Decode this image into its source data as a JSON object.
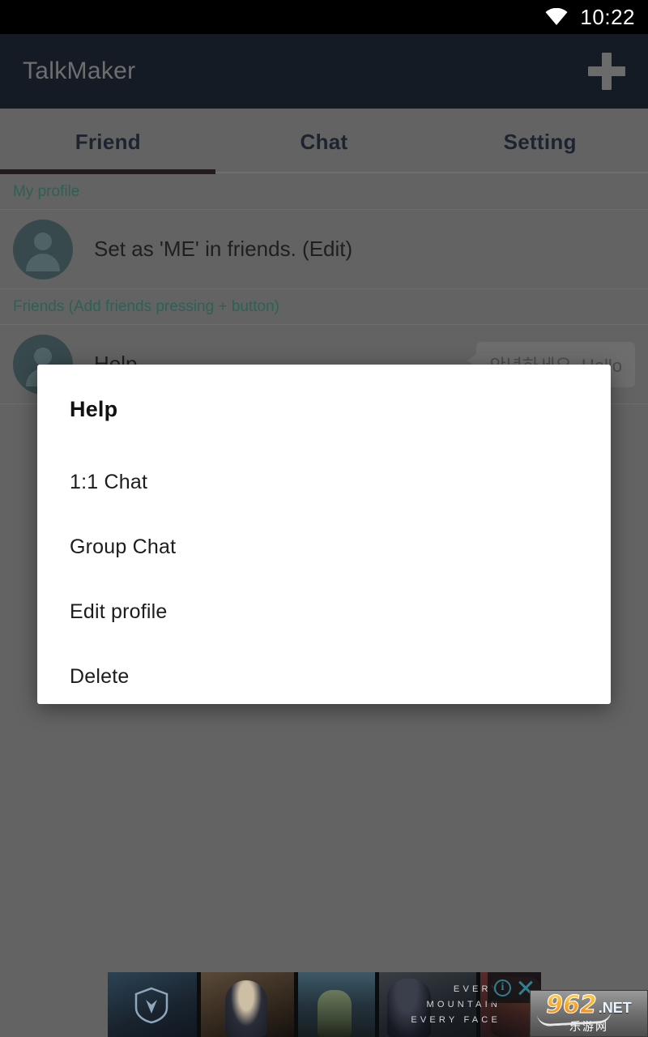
{
  "status_bar": {
    "time": "10:22",
    "wifi_icon": "wifi-icon"
  },
  "app_bar": {
    "title": "TalkMaker",
    "add_icon": "plus-icon"
  },
  "tabs": [
    {
      "label": "Friend",
      "active": true
    },
    {
      "label": "Chat",
      "active": false
    },
    {
      "label": "Setting",
      "active": false
    }
  ],
  "content": {
    "sections": [
      {
        "header": "My profile",
        "rows": [
          {
            "label": "Set as 'ME' in friends. (Edit)",
            "bubble": ""
          }
        ]
      },
      {
        "header": "Friends (Add friends pressing + button)",
        "rows": [
          {
            "label": "Help",
            "bubble": "안녕하세요, Hello"
          }
        ]
      }
    ]
  },
  "dialog": {
    "title": "Help",
    "items": [
      "1:1 Chat",
      "Group Chat",
      "Edit profile",
      "Delete"
    ]
  },
  "ad": {
    "copy_line1": "EVERY",
    "copy_line2": "MOUNTAIN",
    "copy_line3": "EVERY FACE",
    "info_label": "i",
    "info_icon": "ad-info-icon",
    "close_icon": "ad-close-icon"
  },
  "watermark": {
    "number": "962",
    "tld": ".NET",
    "chinese": "乐游网"
  },
  "colors": {
    "status_bar_bg": "#000000",
    "app_bar_bg": "#151b24",
    "content_bg": "#636363",
    "section_header_text": "#2d6155",
    "avatar_bg": "#37494c",
    "tab_indicator": "#241c1c",
    "dialog_bg": "#ffffff",
    "ad_accent": "#2f7f92"
  }
}
